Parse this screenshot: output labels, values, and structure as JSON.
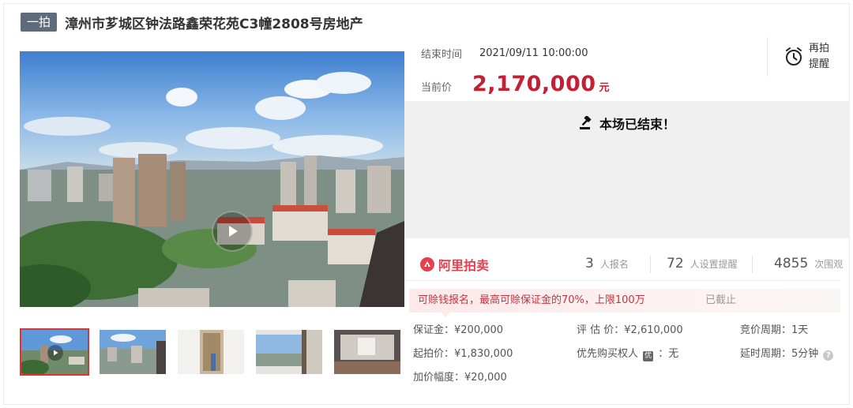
{
  "header": {
    "badge": "一拍",
    "title": "漳州市芗城区钟法路鑫荣花苑C3幢2808号房地产"
  },
  "auction": {
    "end_time_label": "结束时间",
    "end_time_value": "2021/09/11 10:00:00",
    "current_price_label": "当前价",
    "current_price_value": "2,170,000",
    "currency_unit": "元",
    "remind_line1": "再拍",
    "remind_line2": "提醒",
    "ended_text": "本场已结束！"
  },
  "stats": {
    "logo_text": "阿里拍卖",
    "signups_num": "3",
    "signups_label": "人报名",
    "reminders_num": "72",
    "reminders_label": "人设置提醒",
    "views_num": "4855",
    "views_label": "次围观"
  },
  "notice": {
    "text": "可赊钱报名，最高可赊保证金的70%，上限100万",
    "status": "已截止"
  },
  "details": {
    "deposit": "保证金：¥200,000",
    "appraisal": "评 估 价：¥2,610,000",
    "bid_cycle": "竞价周期：1天",
    "start_price": "起拍价：¥1,830,000",
    "priority_label": "优先购买权人",
    "priority_tag": "优",
    "priority_value": "：无",
    "delay_cycle": "延时周期：5分钟",
    "increment": "加价幅度：¥20,000"
  },
  "icons": {
    "play": "play-icon",
    "alarm": "alarm-clock-icon",
    "gavel": "gavel-icon",
    "logo": "ali-auction-logo-icon",
    "help": "help-icon"
  },
  "colors": {
    "price_red": "#c31f35",
    "notice_red": "#c8323e",
    "badge_gray": "#5f6b7a",
    "active_thumb": "#d93636"
  }
}
